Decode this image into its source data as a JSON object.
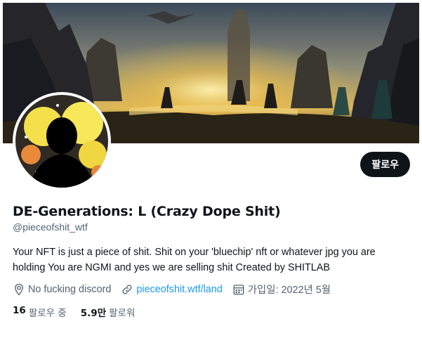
{
  "profile": {
    "display_name": "DE-Generations: L (Crazy Dope Shit)",
    "handle": "@pieceofshit_wtf",
    "bio": "Your NFT is just a piece of shit. Shit on your 'bluechip' nft or whatever jpg you are holding You are NGMI and yes we are selling shit Created by SHITLAB",
    "follow_label": "팔로우"
  },
  "meta": {
    "location": "No fucking discord",
    "link": "pieceofshit.wtf/land",
    "joined": "가입일: 2022년 5월"
  },
  "stats": {
    "following_count": "16",
    "following_label": "팔로우 중",
    "followers_count": "5.9만",
    "followers_label": "팔로워"
  },
  "icons": {
    "location": "location-pin-icon",
    "link": "link-icon",
    "calendar": "calendar-icon"
  },
  "colors": {
    "primary_text": "#0f1419",
    "secondary_text": "#536471",
    "link": "#1d9bf0",
    "button_bg": "#0f1419"
  }
}
